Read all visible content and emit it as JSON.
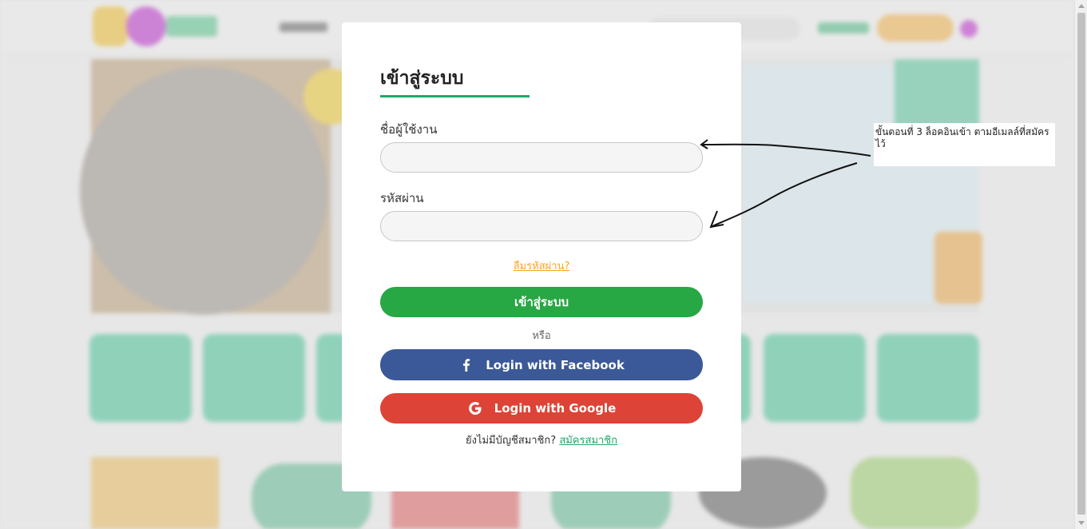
{
  "modal": {
    "title": "เข้าสู่ระบบ",
    "username_label": "ชื่อผู้ใช้งาน",
    "username_value": "",
    "password_label": "รหัสผ่าน",
    "password_value": "",
    "forgot_password": "ลืมรหัสผ่าน?",
    "login_button": "เข้าสู่ระบบ",
    "or_text": "หรือ",
    "facebook_button": "Login with Facebook",
    "google_button": "Login with Google",
    "no_account_text": "ยังไม่มีบัญชีสมาชิก?",
    "signup_link": "สมัครสมาชิก"
  },
  "annotation": {
    "text": "ขั้นตอนที่ 3 ล็อคอินเข้า ตามอีเมลล์ที่สมัครไว้"
  },
  "colors": {
    "accent_green": "#28a745",
    "facebook_blue": "#3b5998",
    "google_red": "#dd4336",
    "forgot_orange": "#f5a623",
    "title_underline": "#1faa6a"
  },
  "icons": {
    "facebook": "facebook-f-icon",
    "google": "google-g-icon"
  }
}
